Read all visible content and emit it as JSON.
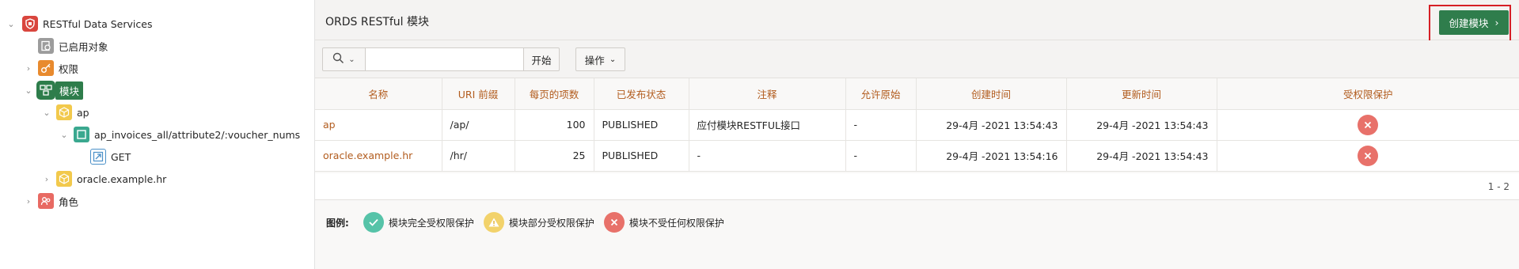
{
  "tree": {
    "root": {
      "label": "RESTful Data Services"
    },
    "enabled_objects": {
      "label": "已启用对象"
    },
    "privileges": {
      "label": "权限"
    },
    "modules": {
      "label": "模块"
    },
    "module_ap": {
      "label": "ap"
    },
    "template": {
      "label": "ap_invoices_all/attribute2/:voucher_nums"
    },
    "handler_get": {
      "label": "GET"
    },
    "module_hr": {
      "label": "oracle.example.hr"
    },
    "roles": {
      "label": "角色"
    }
  },
  "region": {
    "title": "ORDS RESTful 模块",
    "create_button": "创建模块"
  },
  "toolbar": {
    "search_value": "",
    "go_label": "开始",
    "actions_label": "操作"
  },
  "table": {
    "headers": [
      "名称",
      "URI 前缀",
      "每页的项数",
      "已发布状态",
      "注释",
      "允许原始",
      "创建时间",
      "更新时间",
      "受权限保护"
    ],
    "rows": [
      {
        "name": "ap",
        "uri": "/ap/",
        "items": "100",
        "status": "PUBLISHED",
        "comment": "应付模块RESTFUL接口",
        "origins": "-",
        "created": "29-4月 -2021 13:54:43",
        "updated": "29-4月 -2021 13:54:43"
      },
      {
        "name": "oracle.example.hr",
        "uri": "/hr/",
        "items": "25",
        "status": "PUBLISHED",
        "comment": "-",
        "origins": "-",
        "created": "29-4月 -2021 13:54:16",
        "updated": "29-4月 -2021 13:54:43"
      }
    ]
  },
  "pagination": {
    "label": "1 - 2"
  },
  "legend": {
    "title": "图例:",
    "full": "模块完全受权限保护",
    "partial": "模块部分受权限保护",
    "none": "模块不受任何权限保护"
  },
  "colors": {
    "accent_green": "#2f7d4c",
    "link_orange": "#b25c1e",
    "protected_teal": "#56c3a8",
    "partial_yellow": "#f2d26b",
    "unprotected_red": "#e8716a",
    "highlight_red": "#d61f26"
  },
  "icons": {
    "root": "database-shield-icon",
    "enabled_objects": "gear-document-icon",
    "privileges": "key-icon",
    "modules": "modules-icon",
    "module": "cube-icon",
    "template": "template-icon",
    "handler": "handler-arrow-icon",
    "roles": "users-icon",
    "search": "search-icon",
    "delete": "x-circle-icon"
  }
}
